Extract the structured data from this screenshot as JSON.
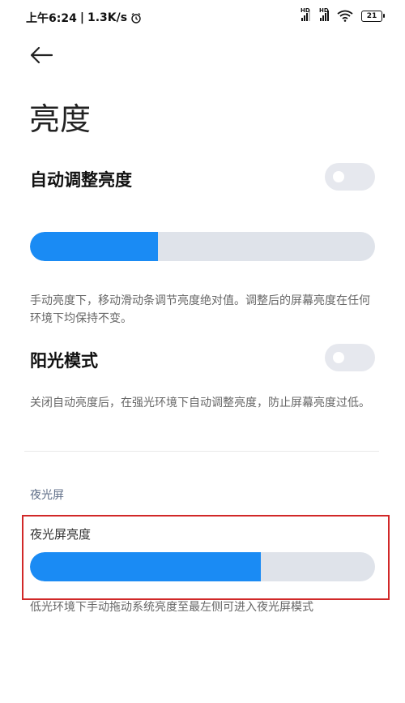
{
  "status_bar": {
    "time": "上午6:24",
    "network_speed": "1.3K/s",
    "battery": "21"
  },
  "header": {
    "title": "亮度"
  },
  "auto_brightness": {
    "label": "自动调整亮度",
    "enabled": false
  },
  "brightness_slider": {
    "value_fraction": 0.37,
    "description": "手动亮度下，移动滑动条调节亮度绝对值。调整后的屏幕亮度在任何环境下均保持不变。"
  },
  "sunlight_mode": {
    "label": "阳光模式",
    "enabled": false,
    "description": "关闭自动亮度后，在强光环境下自动调整亮度，防止屏幕亮度过低。"
  },
  "night_screen": {
    "section_title": "夜光屏",
    "brightness_label": "夜光屏亮度",
    "value_fraction": 0.67,
    "description": "低光环境下手动拖动系统亮度至最左侧可进入夜光屏模式"
  },
  "colors": {
    "accent": "#1a8bf4",
    "highlight_border": "#d12828"
  }
}
